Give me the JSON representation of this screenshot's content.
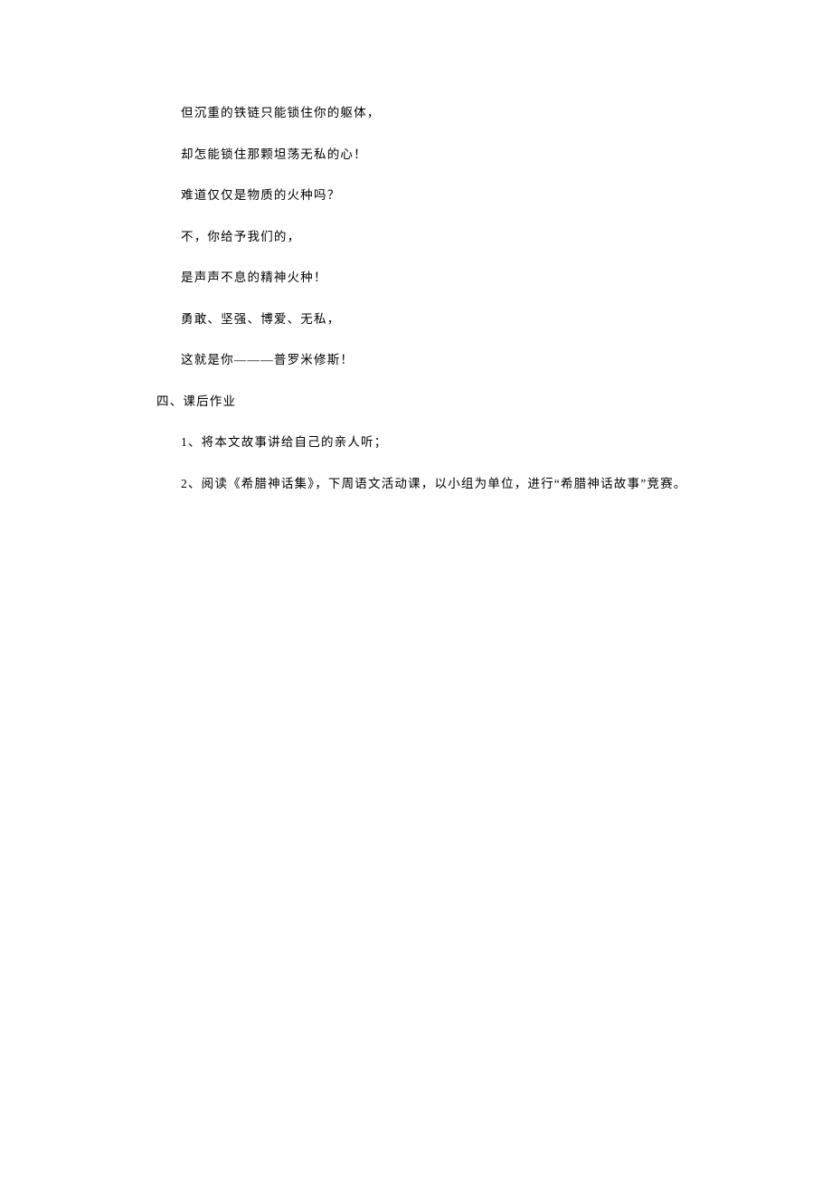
{
  "poem": {
    "l1": "但沉重的铁链只能锁住你的躯体，",
    "l2": "却怎能锁住那颗坦荡无私的心！",
    "l3": "难道仅仅是物质的火种吗？",
    "l4": "不，你给予我们的，",
    "l5": "是声声不息的精神火种！",
    "l6": "勇敢、坚强、博爱、无私，",
    "l7": "这就是你———普罗米修斯！"
  },
  "section": {
    "heading": "四、课后作业"
  },
  "homework": {
    "i1": "1、将本文故事讲给自己的亲人听；",
    "i2": "2、阅读《希腊神话集》，下周语文活动课，以小组为单位，进行“希腊神话故事”竞赛。"
  }
}
